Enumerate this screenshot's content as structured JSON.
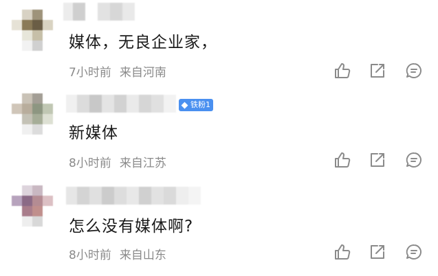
{
  "comments": [
    {
      "text": "媒体，无良企业家，",
      "time": "7小时前",
      "location": "来自河南",
      "badge": ""
    },
    {
      "text": "新媒体",
      "time": "8小时前",
      "location": "来自江苏",
      "badge": "铁粉1"
    },
    {
      "text": "怎么没有媒体啊?",
      "time": "8小时前",
      "location": "来自山东",
      "badge": ""
    }
  ],
  "colors": {
    "text": "#1a1a1a",
    "meta": "#8a8a8a",
    "badge": "#4a90f0",
    "icon": "#8a8a8a"
  },
  "icons": [
    "thumb-up-icon",
    "share-icon",
    "reply-icon"
  ]
}
